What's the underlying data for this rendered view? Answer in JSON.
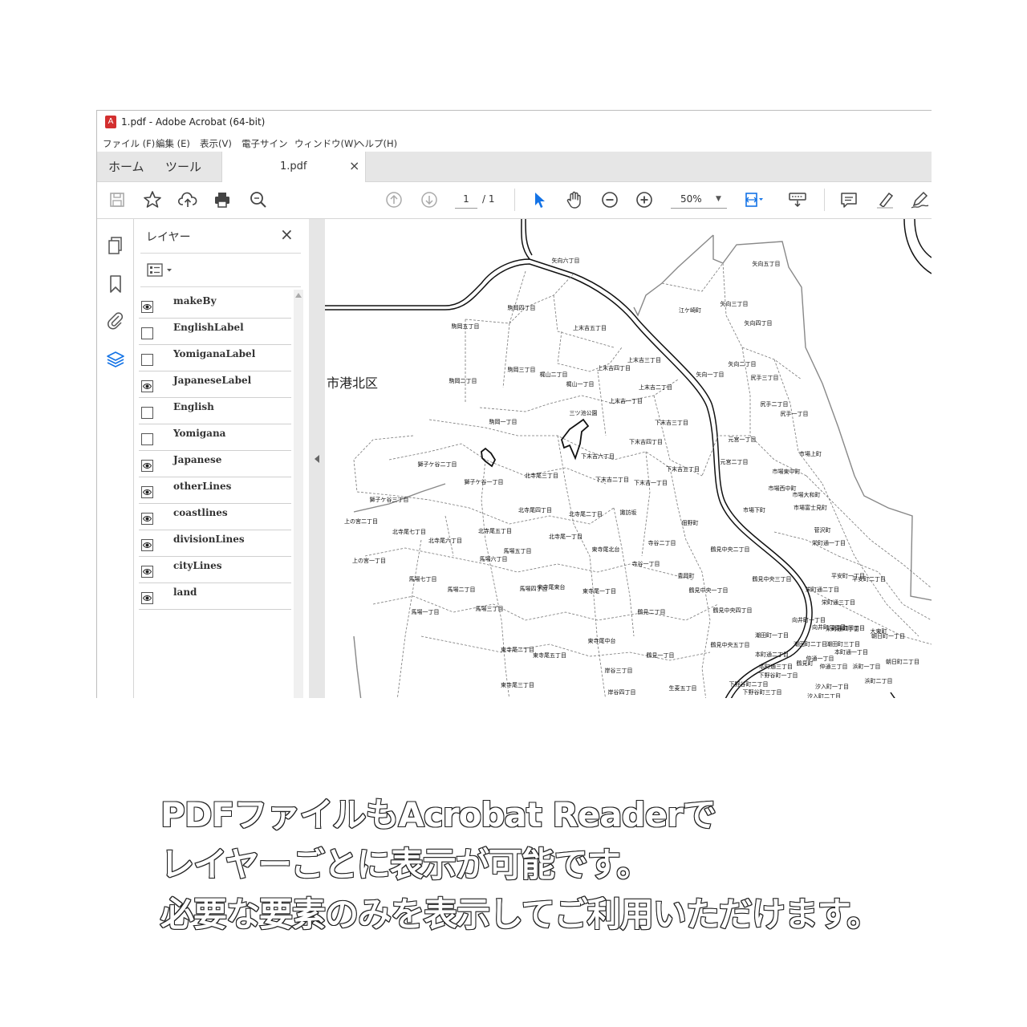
{
  "window": {
    "title": "1.pdf - Adobe Acrobat (64-bit)"
  },
  "menu": [
    "ファイル (F)",
    "編集 (E)",
    "表示(V)",
    "電子サイン",
    "ウィンドウ(W)",
    "ヘルプ(H)"
  ],
  "tabs": {
    "home": "ホーム",
    "tools": "ツール",
    "doc": "1.pdf",
    "close": "×"
  },
  "toolbar": {
    "page_current": "1",
    "page_total": "/ 1",
    "zoom": "50%"
  },
  "layers_panel": {
    "title": "レイヤー",
    "close": "×",
    "items": [
      {
        "name": "makeBy",
        "visible": true
      },
      {
        "name": "EnglishLabel",
        "visible": false
      },
      {
        "name": "YomiganaLabel",
        "visible": false
      },
      {
        "name": "JapaneseLabel",
        "visible": true
      },
      {
        "name": "English",
        "visible": false
      },
      {
        "name": "Yomigana",
        "visible": false
      },
      {
        "name": "Japanese",
        "visible": true
      },
      {
        "name": "otherLines",
        "visible": true
      },
      {
        "name": "coastlines",
        "visible": true
      },
      {
        "name": "divisionLines",
        "visible": true
      },
      {
        "name": "cityLines",
        "visible": true
      },
      {
        "name": "land",
        "visible": true
      }
    ]
  },
  "map": {
    "city_label": "市港北区",
    "labels": [
      "矢向六丁目",
      "矢向五丁目",
      "江ケ崎町",
      "矢向三丁目",
      "矢向四丁目",
      "矢向一丁目",
      "矢向二丁目",
      "尻手三丁目",
      "尻手二丁目",
      "尻手一丁目",
      "駒岡四丁目",
      "駒岡三丁目",
      "駒岡二丁目",
      "駒岡五丁目",
      "上末吉五丁目",
      "上末吉三丁目",
      "上末吉四丁目",
      "上末吉二丁目",
      "上末吉一丁目",
      "梶山二丁目",
      "梶山一丁目",
      "駒岡一丁目",
      "三ツ池公園",
      "下末吉三丁目",
      "下末吉四丁目",
      "下末吉六丁目",
      "下末吉五丁目",
      "下末吉二丁目",
      "下末吉一丁目",
      "元宮一丁目",
      "元宮二丁目",
      "市場上町",
      "市場東中町",
      "市場西中町",
      "市場大和町",
      "市場下町",
      "市場富士見町",
      "獅子ケ谷二丁目",
      "獅子ケ谷一丁目",
      "獅子ケ谷三丁目",
      "北寺尾三丁目",
      "北寺尾四丁目",
      "北寺尾二丁目",
      "北寺尾一丁目",
      "北寺尾七丁目",
      "北寺尾六丁目",
      "北寺尾五丁目",
      "上の宮二丁目",
      "上の宮一丁目",
      "馬場六丁目",
      "馬場五丁目",
      "馬場七丁目",
      "馬場二丁目",
      "馬場三丁目",
      "馬場一丁目",
      "馬場四丁目",
      "諏訪坂",
      "佃野町",
      "寺谷二丁目",
      "寺谷一丁目",
      "東寺尾北台",
      "東寺尾一丁目",
      "東寺尾中台",
      "東寺尾東台",
      "東寺尾五丁目",
      "東寺尾二丁目",
      "東寺尾三丁目",
      "鶴見中央二丁目",
      "鶴見中央三丁目",
      "鶴見中央四丁目",
      "鶴見中央一丁目",
      "鶴見中央五丁目",
      "豊岡町",
      "鶴見二丁目",
      "鶴見一丁目",
      "岸谷三丁目",
      "岸谷四丁目",
      "生麦五丁目",
      "平安町一丁目",
      "平安町二丁目",
      "栄町通一丁目",
      "栄町通二丁目",
      "栄町通三丁目",
      "栄町通四丁目",
      "向井町一丁目",
      "向井町二丁目",
      "向井町四丁目",
      "大東町",
      "朝日町一丁目",
      "朝日町二丁目",
      "潮田町一丁目",
      "潮田町二丁目",
      "潮田町三丁目",
      "本町通一丁目",
      "本町通二丁目",
      "本町通三丁目",
      "仲通一丁目",
      "仲通三丁目",
      "浜町一丁目",
      "浜町二丁目",
      "下野谷町一丁目",
      "下野谷町二丁目",
      "下野谷町三丁目",
      "汐入町一丁目",
      "汐入町二丁目",
      "菅沢町",
      "鶴見町"
    ]
  },
  "caption": {
    "line1": "PDFファイルもAcrobat Readerで",
    "line2": "レイヤーごとに表示が可能です。",
    "line3": "必要な要素のみを表示してご利用いただけます。"
  },
  "colors": {
    "accent": "#1473e6",
    "tab_bg": "#e6e6e6",
    "border": "#d6d6d6",
    "pdf_red": "#d32f2f"
  }
}
